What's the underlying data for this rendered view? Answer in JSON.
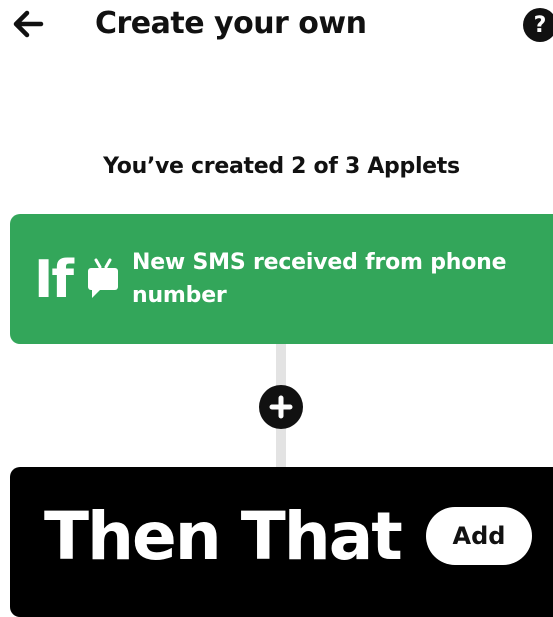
{
  "header": {
    "back_icon": "arrow-left-icon",
    "title": "Create your own",
    "help_label": "?",
    "help_icon": "question-mark-icon"
  },
  "counter_text": "You’ve created 2 of 3 Applets",
  "trigger": {
    "prefix": "If",
    "service_icon": "sms-icon",
    "text": "New SMS received from phone number",
    "color": "#33a65a"
  },
  "connector": {
    "add_icon": "plus-icon"
  },
  "action": {
    "prefix": "Then That",
    "add_label": "Add",
    "color": "#000000"
  }
}
